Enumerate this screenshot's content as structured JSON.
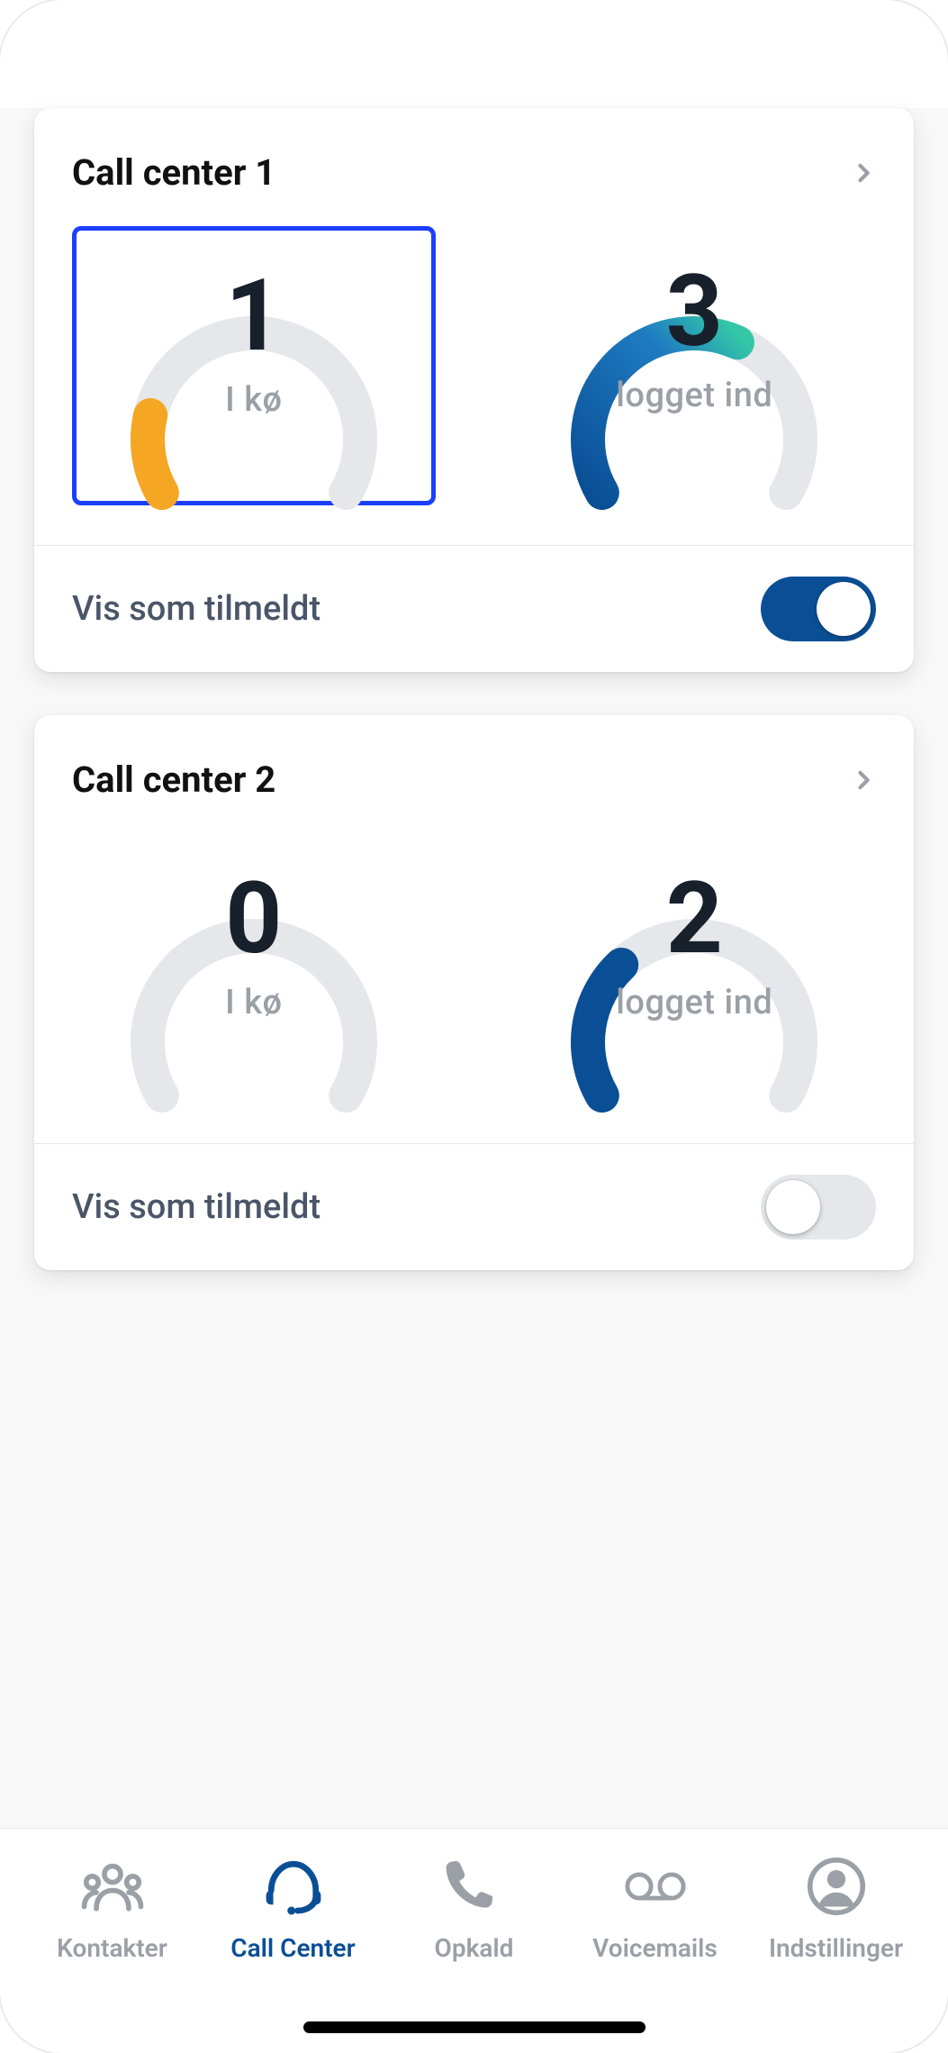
{
  "cards": [
    {
      "title": "Call center 1",
      "queue": {
        "value": "1",
        "label": "I kø",
        "frac": 0.18,
        "stroke": "#f5a623",
        "selected": true
      },
      "logged_in": {
        "value": "3",
        "label": "logget ind",
        "frac": 0.6,
        "stroke": "url(#gradBlueTeal)",
        "selected": false
      },
      "toggle": {
        "label": "Vis som tilmeldt",
        "on": true
      }
    },
    {
      "title": "Call center 2",
      "queue": {
        "value": "0",
        "label": "I kø",
        "frac": 0.0,
        "stroke": "#e5e7eb",
        "selected": false
      },
      "logged_in": {
        "value": "2",
        "label": "logget ind",
        "frac": 0.32,
        "stroke": "#0a4f96",
        "selected": false
      },
      "toggle": {
        "label": "Vis som tilmeldt",
        "on": false
      }
    }
  ],
  "tabs": [
    {
      "label": "Kontakter",
      "active": false
    },
    {
      "label": "Call Center",
      "active": true
    },
    {
      "label": "Opkald",
      "active": false
    },
    {
      "label": "Voicemails",
      "active": false
    },
    {
      "label": "Indstillinger",
      "active": false
    }
  ],
  "colors": {
    "accent": "#0a4f96",
    "selectBorder": "#1b3fff",
    "trackGrey": "#e5e7eb",
    "orange": "#f5a623",
    "teal": "#34c7a7"
  },
  "chart_data": [
    {
      "type": "gauge",
      "title": "Call center 1 — I kø",
      "value": 1,
      "frac": 0.18
    },
    {
      "type": "gauge",
      "title": "Call center 1 — logget ind",
      "value": 3,
      "frac": 0.6
    },
    {
      "type": "gauge",
      "title": "Call center 2 — I kø",
      "value": 0,
      "frac": 0.0
    },
    {
      "type": "gauge",
      "title": "Call center 2 — logget ind",
      "value": 2,
      "frac": 0.32
    }
  ]
}
